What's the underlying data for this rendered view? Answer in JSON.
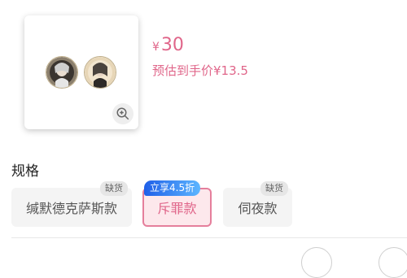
{
  "product": {
    "image_icon": "badge-pair-image",
    "zoom_icon": "zoom-in-icon"
  },
  "price": {
    "currency": "¥",
    "value": "30",
    "estimated": "预估到手价¥13.5"
  },
  "specs": {
    "title": "规格",
    "options": [
      {
        "label": "缄默德克萨斯款",
        "tag": "缺货"
      },
      {
        "label": "斥罪款",
        "promo": "立享4.5折",
        "selected": true
      },
      {
        "label": "伺夜款",
        "tag": "缺货"
      }
    ]
  },
  "colors": {
    "accent": "#e0668a",
    "promo_start": "#1f5fe8",
    "promo_end": "#5db6ff"
  }
}
